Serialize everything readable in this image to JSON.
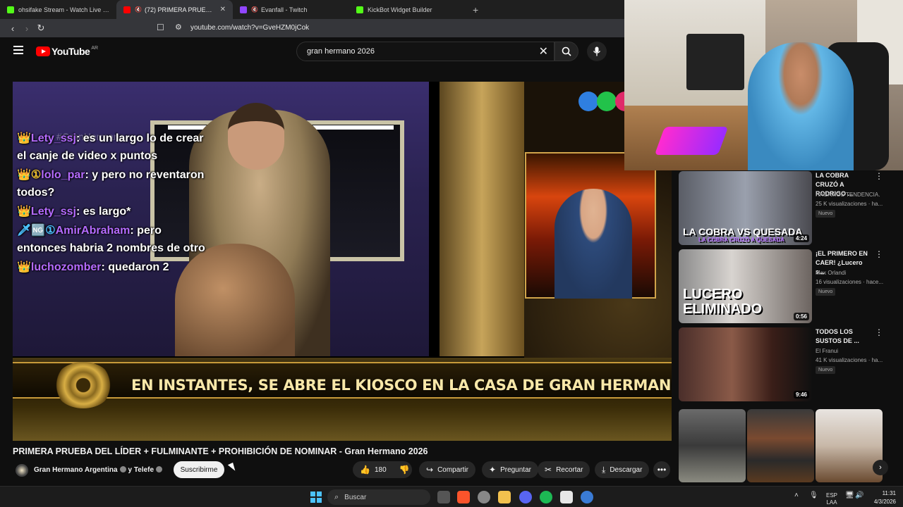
{
  "browser": {
    "tabs": [
      {
        "title": "ohsifake Stream - Watch Live on",
        "favicon_color": "#53fc18"
      },
      {
        "title": "(72) PRIMERA PRUEBA DEL LÍ",
        "favicon_color": "#ff0000",
        "active": true
      },
      {
        "title": "Evanfall - Twitch",
        "favicon_color": "#9146ff"
      },
      {
        "title": "KickBot Widget Builder",
        "favicon_color": "#53fc18"
      }
    ],
    "url": "youtube.com/watch?v=GveHZM0jCok"
  },
  "youtube": {
    "logo_text": "YouTube",
    "region": "AR",
    "search_query": "gran hermano 2026"
  },
  "video": {
    "chat": [
      {
        "badges": "👑",
        "user": "Lety_ssj",
        "user_color": "#b56bff",
        "text": "es un largo lo de crear el canje de video x puntos"
      },
      {
        "badges": "👑①",
        "user": "lolo_par",
        "user_color": "#b56bff",
        "text": "y pero no reventaron todos?"
      },
      {
        "badges": "👑",
        "user": "Lety_ssj",
        "user_color": "#b56bff",
        "text": "es largo*"
      },
      {
        "badges": "🗡🆖①",
        "user": "AmirAbraham",
        "user_color": "#b56bff",
        "text": "pero entonces habria 2 nombres de otro"
      },
      {
        "badges": "👑",
        "user": "luchozomber",
        "user_color": "#b56bff",
        "text": "quedaron 2"
      }
    ],
    "watermark": "#GranHermano",
    "lower_third": "EN INSTANTES, SE ABRE EL KIOSCO EN LA CASA DE GRAN HERMANO",
    "title": "PRIMERA PRUEBA DEL LÍDER + FULMINANTE + PROHIBICIÓN DE NOMINAR - Gran Hermano 2026",
    "channel": "Gran Hermano Argentina",
    "collab": "y Telefe",
    "subscribe_label": "Suscribirme",
    "likes": "180",
    "share_label": "Compartir",
    "ask_label": "Preguntar",
    "clip_label": "Recortar",
    "download_label": "Descargar"
  },
  "recommendations": [
    {
      "title": "LA COBRA CRUZÓ A RODRIGO ...",
      "channel": "HAGAMOS TENDENCIA.",
      "meta": "25 K visualizaciones · ha...",
      "badge": "Nuevo",
      "duration": "4:24",
      "caption": "LA COBRA VS QUESADA",
      "subcaption": "LA COBRA CRUZÓ A QUESADA"
    },
    {
      "title": "¡EL PRIMERO EN CAER! ¿Lucero s...",
      "channel": "Max Orlandi",
      "meta": "16 visualizaciones · hace...",
      "badge": "Nuevo",
      "duration": "0:56",
      "caption": "LUCERO ELIMINADO"
    },
    {
      "title": "TODOS LOS SUSTOS DE ...",
      "channel": "El Franui",
      "meta": "41 K visualizaciones · ha...",
      "badge": "Nuevo",
      "duration": "9:46"
    }
  ],
  "taskbar": {
    "search_placeholder": "Buscar",
    "lang": "ESP",
    "lang2": "LAA",
    "time": "11:31",
    "date": "4/3/2026"
  }
}
